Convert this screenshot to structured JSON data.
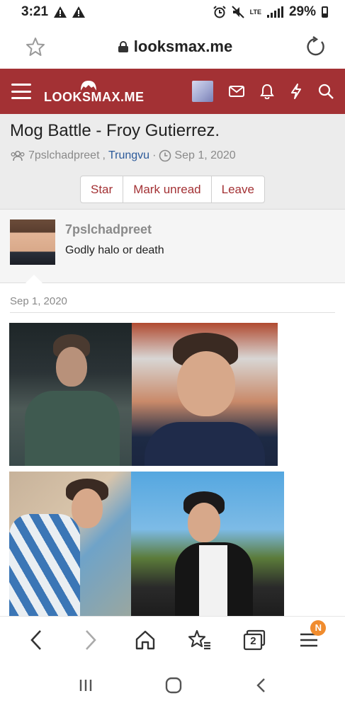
{
  "status_bar": {
    "time": "3:21",
    "network": "LTE",
    "battery_percent": "29%",
    "battery_level": 0.29
  },
  "browser": {
    "url": "looksmax.me"
  },
  "site": {
    "logo_text": "LOOKSMAX.ME",
    "header_color": "#a33134"
  },
  "thread": {
    "title": "Mog Battle - Froy Gutierrez.",
    "participants_a": "7pslchadpreet",
    "separator": ",",
    "participants_b": "Trungvu",
    "dot": "·",
    "date": "Sep 1, 2020",
    "buttons": {
      "star": "Star",
      "mark_unread": "Mark unread",
      "leave": "Leave"
    }
  },
  "first_post": {
    "username": "7pslchadpreet",
    "text": "Godly halo or death"
  },
  "message": {
    "date": "Sep 1, 2020"
  },
  "bottom_bar": {
    "tabs_count": "2",
    "menu_badge": "N"
  }
}
